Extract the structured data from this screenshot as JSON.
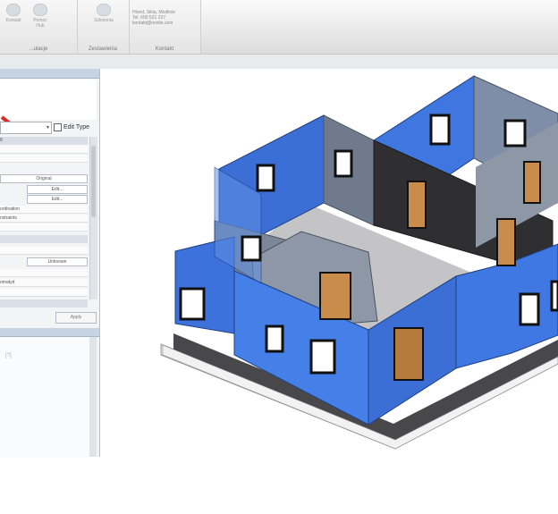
{
  "ribbon": {
    "buttons": [
      {
        "label": "Kontakt",
        "icon": "envelope-icon"
      },
      {
        "label": "Pomoc Hub",
        "icon": "chat-bubble-icon"
      },
      {
        "label": "Szkolenia",
        "icon": "document-icon"
      }
    ],
    "groups": [
      {
        "label": "...ulacje"
      },
      {
        "label": "Zestawienia"
      },
      {
        "label": "Kontakt"
      }
    ],
    "contact": {
      "name": "Hlond, Sikla, Modlinie",
      "phone": "Tel. 600 521 237",
      "email": "kontakt@revitle.com"
    }
  },
  "properties": {
    "edit_type_label": "Edit Type",
    "rows": [
      "8",
      "",
      "Original",
      "Edit...",
      "Edit...",
      "ordination",
      "nstraints",
      "",
      "",
      "",
      "Unknown",
      "",
      "omatyd",
      "",
      "",
      ""
    ],
    "apply_label": "Apply",
    "lower_text": "[?]"
  },
  "colors": {
    "wall_exterior": "#3f74dc",
    "wall_interior": "#8d97a6",
    "wall_dark": "#2f2f31",
    "floor": "#c4c4c6",
    "foundation": "#4a4a4d"
  }
}
